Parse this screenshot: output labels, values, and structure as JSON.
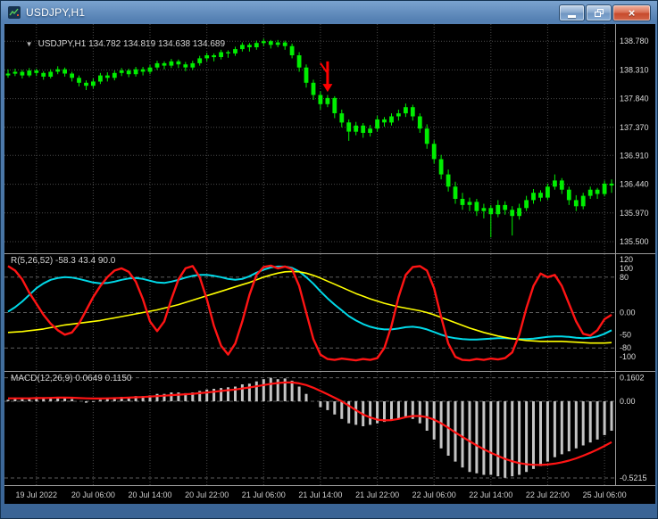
{
  "window": {
    "title": "USDJPY,H1",
    "collapse_glyph": "▼",
    "controls": {
      "minimize": "minimize-icon",
      "restore": "restore-icon",
      "close_glyph": "×"
    }
  },
  "colors": {
    "background": "#000000",
    "candle": "#00ee00",
    "grid": "#4a4a4a",
    "level": "#5e5e5e",
    "separator": "#9a9a9a",
    "scale_text": "#dcdcdc",
    "time_text": "#cfcfcf",
    "annotation_red": "#ff0000",
    "histogram": "#c4c4c4",
    "signal_red": "#ff1414"
  },
  "chart_data": [
    {
      "type": "candlestick",
      "title": "USDJPY,H1",
      "legend": "USDJPY,H1 134.782 134.819 134.638 134.689",
      "ylim": [
        135.31,
        139.06
      ],
      "y_ticks": [
        {
          "value": 138.78,
          "label": "138.780"
        },
        {
          "value": 138.31,
          "label": "138.310"
        },
        {
          "value": 137.84,
          "label": "137.840"
        },
        {
          "value": 137.37,
          "label": "137.370"
        },
        {
          "value": 136.91,
          "label": "136.910"
        },
        {
          "value": 136.44,
          "label": "136.440"
        },
        {
          "value": 135.97,
          "label": "135.970"
        },
        {
          "value": 135.5,
          "label": "135.500"
        }
      ],
      "x_labels": [
        {
          "bar": 4,
          "label": "19 Jul 2022"
        },
        {
          "bar": 12,
          "label": "20 Jul 06:00"
        },
        {
          "bar": 20,
          "label": "20 Jul 14:00"
        },
        {
          "bar": 28,
          "label": "20 Jul 22:00"
        },
        {
          "bar": 36,
          "label": "21 Jul 06:00"
        },
        {
          "bar": 44,
          "label": "21 Jul 14:00"
        },
        {
          "bar": 52,
          "label": "21 Jul 22:00"
        },
        {
          "bar": 60,
          "label": "22 Jul 06:00"
        },
        {
          "bar": 68,
          "label": "22 Jul 14:00"
        },
        {
          "bar": 76,
          "label": "22 Jul 22:00"
        },
        {
          "bar": 84,
          "label": "25 Jul 06:00"
        }
      ],
      "annotation": {
        "type": "sell-down-arrow",
        "bar": 45,
        "from": 138.45,
        "to": 137.95,
        "color": "#ff0000"
      },
      "ohlc": [
        [
          138.22,
          138.32,
          138.18,
          138.25
        ],
        [
          138.25,
          138.33,
          138.21,
          138.28
        ],
        [
          138.28,
          138.31,
          138.17,
          138.22
        ],
        [
          138.22,
          138.34,
          138.19,
          138.3
        ],
        [
          138.3,
          138.33,
          138.21,
          138.26
        ],
        [
          138.26,
          138.29,
          138.15,
          138.2
        ],
        [
          138.2,
          138.32,
          138.17,
          138.28
        ],
        [
          138.28,
          138.37,
          138.24,
          138.32
        ],
        [
          138.32,
          138.35,
          138.2,
          138.25
        ],
        [
          138.25,
          138.28,
          138.12,
          138.18
        ],
        [
          138.18,
          138.22,
          138.04,
          138.1
        ],
        [
          138.1,
          138.14,
          137.98,
          138.05
        ],
        [
          138.05,
          138.17,
          138.01,
          138.12
        ],
        [
          138.12,
          138.26,
          138.08,
          138.22
        ],
        [
          138.22,
          138.27,
          138.12,
          138.18
        ],
        [
          138.18,
          138.3,
          138.14,
          138.26
        ],
        [
          138.26,
          138.34,
          138.21,
          138.3
        ],
        [
          138.3,
          138.33,
          138.19,
          138.24
        ],
        [
          138.24,
          138.36,
          138.2,
          138.32
        ],
        [
          138.32,
          138.36,
          138.22,
          138.28
        ],
        [
          138.28,
          138.39,
          138.24,
          138.35
        ],
        [
          138.35,
          138.46,
          138.31,
          138.42
        ],
        [
          138.42,
          138.45,
          138.32,
          138.38
        ],
        [
          138.38,
          138.49,
          138.34,
          138.45
        ],
        [
          138.45,
          138.48,
          138.34,
          138.4
        ],
        [
          138.4,
          138.44,
          138.29,
          138.35
        ],
        [
          138.35,
          138.46,
          138.31,
          138.42
        ],
        [
          138.42,
          138.54,
          138.38,
          138.5
        ],
        [
          138.5,
          138.59,
          138.45,
          138.55
        ],
        [
          138.55,
          138.58,
          138.45,
          138.52
        ],
        [
          138.52,
          138.64,
          138.48,
          138.6
        ],
        [
          138.6,
          138.63,
          138.51,
          138.58
        ],
        [
          138.58,
          138.69,
          138.54,
          138.65
        ],
        [
          138.65,
          138.76,
          138.61,
          138.72
        ],
        [
          138.72,
          138.75,
          138.61,
          138.68
        ],
        [
          138.68,
          138.79,
          138.64,
          138.75
        ],
        [
          138.75,
          138.82,
          138.7,
          138.78
        ],
        [
          138.78,
          138.8,
          138.66,
          138.72
        ],
        [
          138.72,
          138.8,
          138.68,
          138.76
        ],
        [
          138.76,
          138.79,
          138.64,
          138.7
        ],
        [
          138.7,
          138.74,
          138.5,
          138.55
        ],
        [
          138.55,
          138.6,
          138.28,
          138.35
        ],
        [
          138.35,
          138.4,
          138.02,
          138.1
        ],
        [
          138.1,
          138.15,
          137.82,
          137.9
        ],
        [
          137.9,
          137.96,
          137.66,
          137.75
        ],
        [
          137.75,
          137.9,
          137.7,
          137.85
        ],
        [
          137.85,
          137.88,
          137.52,
          137.6
        ],
        [
          137.6,
          137.66,
          137.37,
          137.45
        ],
        [
          137.45,
          137.5,
          137.15,
          137.3
        ],
        [
          137.3,
          137.46,
          137.24,
          137.4
        ],
        [
          137.4,
          137.44,
          137.2,
          137.28
        ],
        [
          137.28,
          137.41,
          137.22,
          137.35
        ],
        [
          137.35,
          137.56,
          137.3,
          137.5
        ],
        [
          137.5,
          137.54,
          137.38,
          137.45
        ],
        [
          137.45,
          137.6,
          137.4,
          137.55
        ],
        [
          137.55,
          137.66,
          137.48,
          137.6
        ],
        [
          137.6,
          137.76,
          137.54,
          137.7
        ],
        [
          137.7,
          137.74,
          137.48,
          137.55
        ],
        [
          137.55,
          137.6,
          137.28,
          137.35
        ],
        [
          137.35,
          137.42,
          137.02,
          137.1
        ],
        [
          137.1,
          137.16,
          136.78,
          136.85
        ],
        [
          136.85,
          136.92,
          136.52,
          136.6
        ],
        [
          136.6,
          136.68,
          136.32,
          136.4
        ],
        [
          136.4,
          136.48,
          136.12,
          136.2
        ],
        [
          136.2,
          136.3,
          136.02,
          136.1
        ],
        [
          136.1,
          136.22,
          136.0,
          136.15
        ],
        [
          136.15,
          136.2,
          135.92,
          136.0
        ],
        [
          136.0,
          136.12,
          135.88,
          136.05
        ],
        [
          136.05,
          136.1,
          135.57,
          135.95
        ],
        [
          135.95,
          136.18,
          135.9,
          136.1
        ],
        [
          136.1,
          136.16,
          135.94,
          136.02
        ],
        [
          136.02,
          136.08,
          135.6,
          135.92
        ],
        [
          135.92,
          136.12,
          135.86,
          136.05
        ],
        [
          136.05,
          136.25,
          136.0,
          136.18
        ],
        [
          136.18,
          136.36,
          136.12,
          136.3
        ],
        [
          136.3,
          136.34,
          136.16,
          136.22
        ],
        [
          136.22,
          136.45,
          136.18,
          136.4
        ],
        [
          136.4,
          136.6,
          136.35,
          136.5
        ],
        [
          136.5,
          136.54,
          136.28,
          136.35
        ],
        [
          136.35,
          136.4,
          136.1,
          136.18
        ],
        [
          136.18,
          136.26,
          136.0,
          136.08
        ],
        [
          136.08,
          136.3,
          136.03,
          136.25
        ],
        [
          136.25,
          136.4,
          136.2,
          136.35
        ],
        [
          136.35,
          136.38,
          136.2,
          136.28
        ],
        [
          136.28,
          136.5,
          136.24,
          136.45
        ],
        [
          136.45,
          136.52,
          136.3,
          136.42
        ]
      ]
    },
    {
      "type": "line",
      "title": "R(5,26,52)",
      "legend": "R(5,26,52) -58.3 43.4 90.0",
      "ylim": [
        -132,
        132
      ],
      "levels": [
        80,
        0,
        -80
      ],
      "y_ticks": [
        {
          "value": 120,
          "label": "120"
        },
        {
          "value": 100,
          "label": "100"
        },
        {
          "value": 80,
          "label": "80"
        },
        {
          "value": 0,
          "label": "0.00"
        },
        {
          "value": -50,
          "label": "-50"
        },
        {
          "value": -80,
          "label": "-80"
        },
        {
          "value": -100,
          "label": "-100"
        }
      ],
      "series": [
        {
          "name": "cyan-line",
          "color": "#00d9e8",
          "width": 2,
          "values": [
            2,
            12,
            25,
            40,
            55,
            66,
            74,
            78,
            80,
            79,
            76,
            72,
            68,
            66,
            67,
            70,
            74,
            77,
            78,
            76,
            72,
            68,
            67,
            70,
            74,
            79,
            83,
            85,
            85,
            83,
            80,
            76,
            74,
            76,
            82,
            90,
            97,
            102,
            104,
            104,
            101,
            93,
            80,
            65,
            48,
            32,
            18,
            5,
            -8,
            -18,
            -26,
            -32,
            -36,
            -38,
            -38,
            -36,
            -33,
            -32,
            -34,
            -38,
            -44,
            -50,
            -55,
            -58,
            -60,
            -61,
            -61,
            -60,
            -59,
            -58,
            -58,
            -59,
            -60,
            -60,
            -59,
            -57,
            -55,
            -54,
            -54,
            -55,
            -57,
            -58,
            -57,
            -54,
            -48,
            -40
          ]
        },
        {
          "name": "yellow-line",
          "color": "#ffff00",
          "width": 1.6,
          "values": [
            -45,
            -44,
            -43,
            -41,
            -39,
            -37,
            -34,
            -31,
            -28,
            -26,
            -24,
            -22,
            -20,
            -18,
            -15,
            -12,
            -9,
            -6,
            -3,
            0,
            3,
            6,
            10,
            14,
            18,
            23,
            28,
            33,
            38,
            43,
            48,
            53,
            58,
            63,
            68,
            74,
            80,
            85,
            89,
            92,
            93,
            92,
            89,
            84,
            78,
            71,
            64,
            57,
            50,
            43,
            37,
            31,
            26,
            21,
            17,
            13,
            10,
            7,
            4,
            0,
            -5,
            -11,
            -17,
            -23,
            -29,
            -35,
            -40,
            -45,
            -49,
            -53,
            -56,
            -59,
            -61,
            -63,
            -64,
            -65,
            -65,
            -65,
            -65,
            -66,
            -67,
            -68,
            -69,
            -69,
            -69,
            -68
          ]
        },
        {
          "name": "red-line",
          "color": "#ff1414",
          "width": 2.4,
          "values": [
            105,
            95,
            75,
            45,
            20,
            -5,
            -25,
            -40,
            -50,
            -45,
            -25,
            5,
            35,
            60,
            80,
            95,
            100,
            92,
            70,
            30,
            -20,
            -42,
            -20,
            30,
            75,
            100,
            105,
            80,
            30,
            -30,
            -75,
            -95,
            -70,
            -20,
            40,
            85,
            103,
            106,
            100,
            104,
            98,
            60,
            0,
            -60,
            -95,
            -105,
            -107,
            -104,
            -106,
            -108,
            -105,
            -107,
            -103,
            -80,
            -30,
            35,
            85,
            103,
            105,
            95,
            55,
            -10,
            -70,
            -100,
            -107,
            -108,
            -105,
            -107,
            -104,
            -106,
            -103,
            -90,
            -50,
            10,
            60,
            88,
            80,
            85,
            60,
            20,
            -20,
            -48,
            -52,
            -40,
            -15,
            -5
          ]
        }
      ]
    },
    {
      "type": "macd",
      "title": "MACD(12,26,9)",
      "legend": "MACD(12,26,9) 0.0649 0.1150",
      "ylim": [
        -0.57,
        0.2
      ],
      "levels": [
        0.1602,
        0,
        -0.5215
      ],
      "y_ticks": [
        {
          "value": 0.1602,
          "label": "0.1602"
        },
        {
          "value": 0,
          "label": "0.00"
        },
        {
          "value": -0.5215,
          "label": "-0.5215"
        }
      ],
      "histogram": [
        0.01,
        0.02,
        0.015,
        0.02,
        0.025,
        0.02,
        0.02,
        0.03,
        0.025,
        0.015,
        0.0,
        -0.01,
        -0.005,
        0.01,
        0.015,
        0.02,
        0.03,
        0.03,
        0.035,
        0.035,
        0.04,
        0.05,
        0.05,
        0.06,
        0.06,
        0.055,
        0.06,
        0.07,
        0.08,
        0.085,
        0.09,
        0.095,
        0.1,
        0.115,
        0.12,
        0.135,
        0.15,
        0.16,
        0.15,
        0.155,
        0.14,
        0.1,
        0.05,
        0.0,
        -0.04,
        -0.06,
        -0.09,
        -0.12,
        -0.15,
        -0.16,
        -0.17,
        -0.16,
        -0.15,
        -0.14,
        -0.13,
        -0.12,
        -0.11,
        -0.12,
        -0.15,
        -0.2,
        -0.26,
        -0.32,
        -0.37,
        -0.41,
        -0.45,
        -0.48,
        -0.49,
        -0.5,
        -0.5,
        -0.51,
        -0.52,
        -0.51,
        -0.5,
        -0.48,
        -0.46,
        -0.44,
        -0.41,
        -0.38,
        -0.36,
        -0.34,
        -0.32,
        -0.3,
        -0.28,
        -0.26,
        -0.23,
        -0.2
      ],
      "signal": [
        0.02,
        0.02,
        0.02,
        0.02,
        0.022,
        0.022,
        0.023,
        0.025,
        0.025,
        0.024,
        0.022,
        0.02,
        0.019,
        0.019,
        0.02,
        0.021,
        0.023,
        0.025,
        0.027,
        0.029,
        0.032,
        0.035,
        0.038,
        0.042,
        0.045,
        0.048,
        0.051,
        0.055,
        0.06,
        0.065,
        0.07,
        0.075,
        0.08,
        0.087,
        0.094,
        0.102,
        0.11,
        0.118,
        0.124,
        0.128,
        0.128,
        0.122,
        0.11,
        0.092,
        0.07,
        0.048,
        0.024,
        0.0,
        -0.03,
        -0.06,
        -0.09,
        -0.11,
        -0.125,
        -0.13,
        -0.128,
        -0.12,
        -0.108,
        -0.1,
        -0.1,
        -0.108,
        -0.125,
        -0.15,
        -0.18,
        -0.212,
        -0.242,
        -0.272,
        -0.3,
        -0.326,
        -0.35,
        -0.372,
        -0.392,
        -0.408,
        -0.42,
        -0.428,
        -0.432,
        -0.433,
        -0.43,
        -0.424,
        -0.415,
        -0.403,
        -0.388,
        -0.37,
        -0.35,
        -0.328,
        -0.304,
        -0.278
      ]
    }
  ]
}
